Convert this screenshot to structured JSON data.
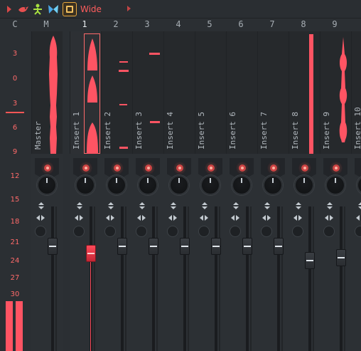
{
  "toolbar": {
    "icons": [
      "arrow-right-icon",
      "bird-icon",
      "person-icon",
      "butterfly-icon",
      "wide-icon"
    ],
    "wide_label": "Wide",
    "accent": "#ff5d5d"
  },
  "header": {
    "labels": [
      "C",
      "M",
      "1",
      "2",
      "3",
      "4",
      "5",
      "6",
      "7",
      "8",
      "9"
    ]
  },
  "scale": {
    "labels": [
      "3",
      "0",
      "3",
      "6",
      "9",
      "12",
      "15",
      "18",
      "21",
      "24",
      "27",
      "30"
    ]
  },
  "channels": [
    {
      "name": "Master"
    },
    {
      "name": "Insert 1"
    },
    {
      "name": "Insert 2"
    },
    {
      "name": "Insert 3"
    },
    {
      "name": "Insert 4"
    },
    {
      "name": "Insert 5"
    },
    {
      "name": "Insert 6"
    },
    {
      "name": "Insert 7"
    },
    {
      "name": "Insert 8"
    },
    {
      "name": "Insert 9"
    },
    {
      "name": "Insert 10"
    }
  ],
  "colors": {
    "meter": "#ff5463",
    "selection": "#ff6a6a",
    "background": "#2b2f33"
  }
}
